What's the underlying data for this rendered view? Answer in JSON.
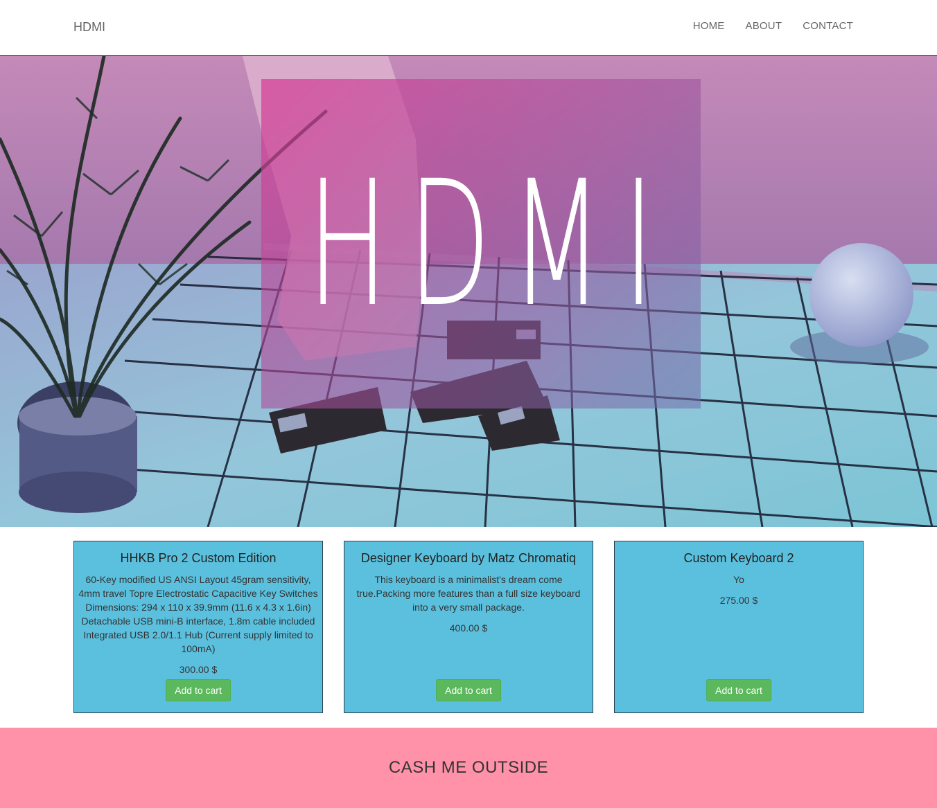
{
  "navbar": {
    "brand": "HDMI",
    "links": [
      "HOME",
      "ABOUT",
      "CONTACT"
    ]
  },
  "hero": {
    "title": "HDMI"
  },
  "products": [
    {
      "name": "HHKB Pro 2 Custom Edition",
      "description": "60-Key modified US ANSI Layout 45gram sensitivity, 4mm travel Topre Electrostatic Capacitive Key Switches Dimensions: 294 x 110 x 39.9mm (11.6 x 4.3 x 1.6in) Detachable USB mini-B interface, 1.8m cable included Integrated USB 2.0/1.1 Hub (Current supply limited to 100mA)",
      "price": "300.00 $",
      "button": "Add to cart"
    },
    {
      "name": "Designer Keyboard by Matz Chromatiq",
      "description": "This keyboard is a minimalist's dream come true.Packing more features than a full size keyboard into a very small package.",
      "price": "400.00 $",
      "button": "Add to cart"
    },
    {
      "name": "Custom Keyboard 2",
      "description": "Yo",
      "price": "275.00 $",
      "button": "Add to cart"
    }
  ],
  "footer": {
    "text": "CASH ME OUTSIDE"
  },
  "colors": {
    "card_bg": "#5bc0de",
    "button_bg": "#5cb85c",
    "footer_bg": "#ff91a9"
  }
}
